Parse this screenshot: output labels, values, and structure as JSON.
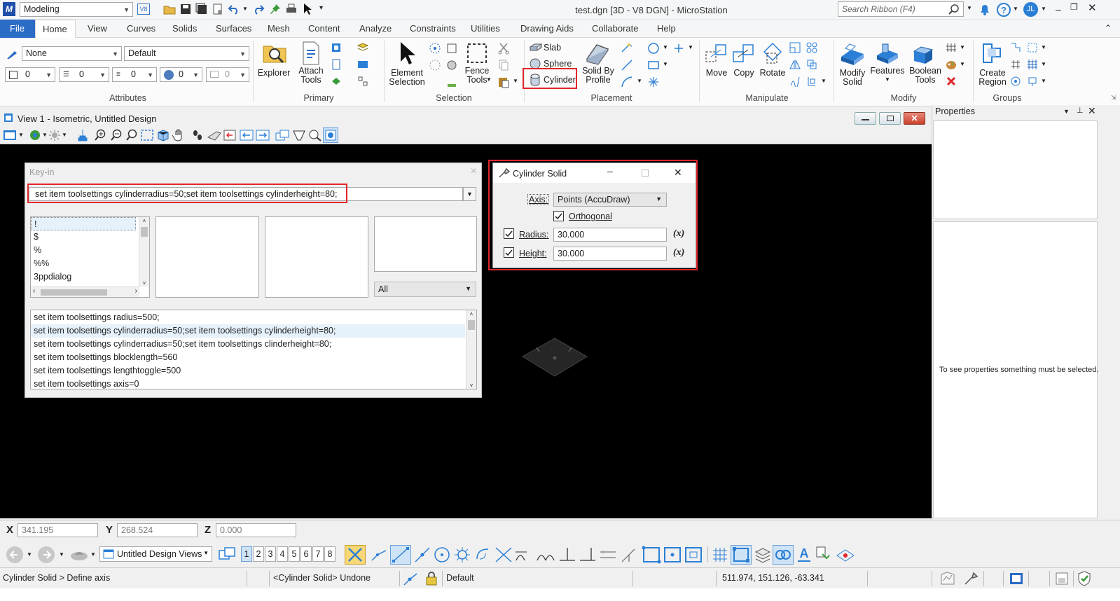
{
  "titlebar": {
    "workflow": "Modeling",
    "version_badge": "V8",
    "title": "test.dgn [3D - V8 DGN] - MicroStation",
    "search_placeholder": "Search Ribbon (F4)",
    "user_initials": "JL"
  },
  "tabs": [
    "File",
    "Home",
    "View",
    "Curves",
    "Solids",
    "Surfaces",
    "Mesh",
    "Content",
    "Analyze",
    "Constraints",
    "Utilities",
    "Drawing Aids",
    "Collaborate",
    "Help"
  ],
  "active_tab": "Home",
  "ribbon": {
    "attributes": {
      "level": "None",
      "style": "Default",
      "color": "0",
      "weight": "0",
      "linestyle": "0",
      "transparency": "0",
      "priority": "0",
      "label": "Attributes"
    },
    "primary": {
      "explorer": "Explorer",
      "attach_tools": "Attach\nTools",
      "label": "Primary"
    },
    "selection": {
      "element_selection": "Element\nSelection",
      "fence_tools": "Fence\nTools",
      "label": "Selection"
    },
    "placement": {
      "slab": "Slab",
      "sphere": "Sphere",
      "cylinder": "Cylinder",
      "solid_by_profile": "Solid By\nProfile",
      "label": "Placement"
    },
    "manipulate": {
      "move": "Move",
      "copy": "Copy",
      "rotate": "Rotate",
      "label": "Manipulate"
    },
    "modify": {
      "modify_solid": "Modify\nSolid",
      "features": "Features",
      "boolean_tools": "Boolean\nTools",
      "label": "Modify"
    },
    "groups": {
      "create_region": "Create\nRegion",
      "label": "Groups"
    }
  },
  "view": {
    "title": "View 1 - Isometric, Untitled Design"
  },
  "keyin": {
    "title": "Key-in",
    "input_value": "set item toolsettings cylinderradius=50;set item toolsettings cylinderheight=80;",
    "commands": [
      "!",
      "$",
      "%",
      "%%",
      "3ppdialog"
    ],
    "filter": "All",
    "history": [
      "set item toolsettings radius=500;",
      "set item toolsettings cylinderradius=50;set item toolsettings cylinderheight=80;",
      "set item toolsettings cylinderradius=50;set item toolsettings clinderheight=80;",
      "set item toolsettings blocklength=560",
      "set item toolsettings lengthtoggle=500",
      "set item toolsettings axis=0"
    ],
    "history_selected_index": 1
  },
  "cylinder_dialog": {
    "title": "Cylinder Solid",
    "axis_label": "Axis:",
    "axis_value": "Points (AccuDraw)",
    "orthogonal_label": "Orthogonal",
    "orthogonal_checked": true,
    "radius_label": "Radius:",
    "radius_value": "30.000",
    "radius_checked": true,
    "height_label": "Height:",
    "height_value": "30.000",
    "height_checked": true,
    "fx": "(x)"
  },
  "properties": {
    "title": "Properties",
    "empty_message": "To see properties something must be selected."
  },
  "coords": {
    "x_label": "X",
    "x": "341.195",
    "y_label": "Y",
    "y": "268.524",
    "z_label": "Z",
    "z": "0.000"
  },
  "views_toolbar": {
    "views_combo": "Untitled Design Views",
    "view_numbers": [
      "1",
      "2",
      "3",
      "4",
      "5",
      "6",
      "7",
      "8"
    ],
    "active_view": "1"
  },
  "status": {
    "prompt": "Cylinder Solid > Define axis",
    "message": "<Cylinder Solid> Undone",
    "level": "Default",
    "position": "511.974, 151.126, -63.341"
  },
  "colors": {
    "highlight_red": "#e0262b",
    "file_tab": "#2b6cc6",
    "viewport_bg": "#000000"
  }
}
